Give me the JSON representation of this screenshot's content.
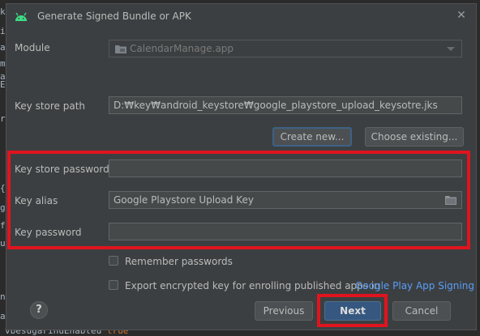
{
  "dialog": {
    "title": "Generate Signed Bundle or APK",
    "module_label": "Module",
    "module_value": "CalendarManage.app",
    "keystore_path_label": "Key store path",
    "keystore_path_value": "D:₩key₩android_keystore₩google_playstore_upload_keysotre.jks",
    "create_new_label": "Create new...",
    "choose_existing_label": "Choose existing...",
    "keystore_password_label": "Key store password",
    "key_alias_label": "Key alias",
    "key_alias_value": "Google Playstore Upload Key",
    "key_password_label": "Key password",
    "remember_passwords_label": "Remember passwords",
    "export_key_label": "Export encrypted key for enrolling published apps in",
    "google_play_link": "Google Play App Signing",
    "help_label": "?",
    "previous_label": "Previous",
    "next_label": "Next",
    "cancel_label": "Cancel"
  },
  "editor": {
    "left_glyphs": [
      "k",
      "i",
      "a",
      "m",
      "a",
      "E",
      "r",
      "{",
      "g",
      "f",
      "u",
      "n",
      "a"
    ],
    "bottom_line_text": "vbesugarinuEnabteu",
    "bottom_line_keyword": "true"
  },
  "colors": {
    "highlight": "#e0141e",
    "android_green": "#3ddc84",
    "link": "#589df6"
  }
}
